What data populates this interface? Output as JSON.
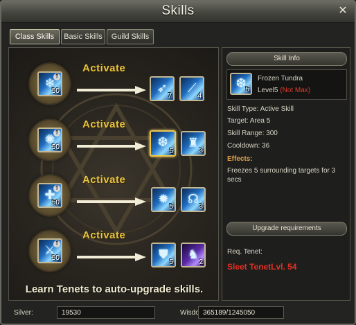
{
  "window": {
    "title": "Skills",
    "close_glyph": "✕"
  },
  "tabs": [
    {
      "label": "Class Skills",
      "active": true
    },
    {
      "label": "Basic Skills",
      "active": false
    },
    {
      "label": "Guild Skills",
      "active": false
    }
  ],
  "rows": [
    {
      "base": {
        "icon": "frost-shard-icon",
        "level": "50"
      },
      "activate_label": "Activate",
      "targets": [
        {
          "icon": "ice-claw-icon",
          "level": "7"
        },
        {
          "icon": "ice-spikes-icon",
          "level": "4"
        }
      ]
    },
    {
      "base": {
        "icon": "frost-aura-icon",
        "level": "50"
      },
      "activate_label": "Activate",
      "targets": [
        {
          "icon": "frozen-tundra-icon",
          "level": "5",
          "selected": true
        },
        {
          "icon": "ice-golem-icon",
          "level": "3"
        }
      ]
    },
    {
      "base": {
        "icon": "holy-cross-icon",
        "level": "50"
      },
      "activate_label": "Activate",
      "targets": [
        {
          "icon": "ice-burst-icon",
          "level": "5"
        },
        {
          "icon": "ice-dragon-icon",
          "level": "3"
        }
      ]
    },
    {
      "base": {
        "icon": "warrior-stance-icon",
        "level": "50"
      },
      "activate_label": "Activate",
      "targets": [
        {
          "icon": "ice-shield-icon",
          "level": "5"
        },
        {
          "icon": "shadow-form-icon",
          "level": "2"
        }
      ]
    }
  ],
  "footer_text": "Learn Tenets to auto-upgrade skills.",
  "skill_info": {
    "header": "Skill Info",
    "name": "Frozen Tundra",
    "level_label": "Level5",
    "level_note": "(Not Max)",
    "icon_level": "5",
    "type": "Skill Type: Active Skill",
    "target": "Target: Area 5",
    "range": "Skill Range: 300",
    "cooldown": "Cooldown: 36",
    "effects_label": "Effects:",
    "effects_text": "Freezes 5 surrounding targets for 3 secs"
  },
  "upgrade": {
    "header": "Upgrade requirements",
    "req_label": "Req. Tenet:",
    "req_value": "Sleet TenetLvl. 54"
  },
  "bottom": {
    "silver_label": "Silver:",
    "silver_value": "19530",
    "wisdom_label": "Wisdom:",
    "wisdom_value": "365189/1245050"
  },
  "colors": {
    "activate": "#e9c43e",
    "not_max": "#e23b2a",
    "effects": "#e0a247",
    "tenet_req": "#e42f22"
  }
}
